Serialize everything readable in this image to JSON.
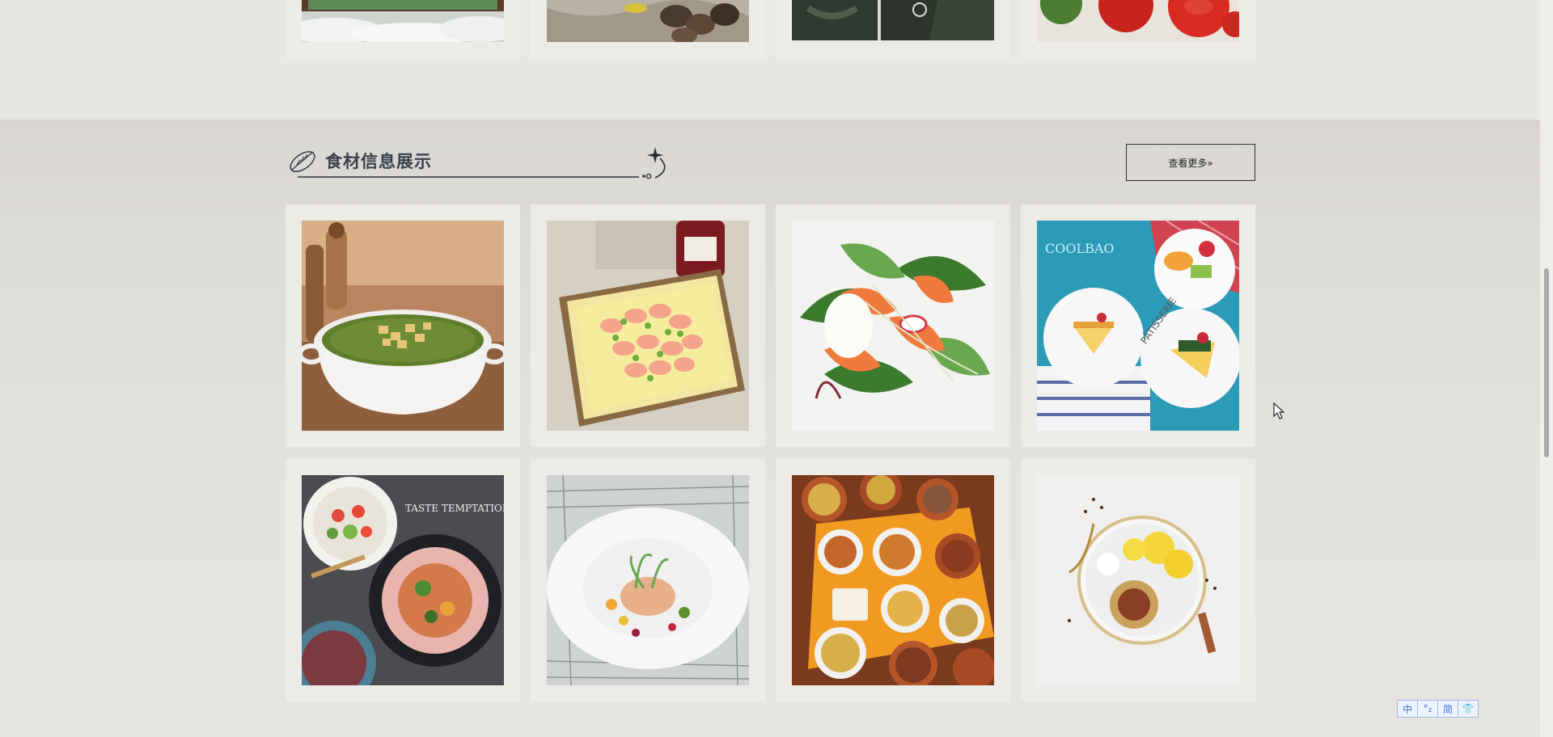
{
  "section": {
    "title": "食材信息展示",
    "more_label": "查看更多»"
  },
  "ime": {
    "items": [
      "中",
      "°₂",
      "简",
      "👕"
    ]
  },
  "colors": {
    "card_bg": "#ecebe8",
    "button_border": "#2f2f2f",
    "title_text": "#3a3f4a"
  },
  "top_row_images": [
    "landscape-with-clouds",
    "mushrooms-on-cloth",
    "dark-produce-collage",
    "red-tomatoes"
  ],
  "food_images": [
    "green-soup-with-croutons",
    "shrimp-and-peas-platter",
    "smoked-salmon-salad",
    "patisserie-cheesecake-plates",
    "taste-temptation-salads",
    "plated-tartare-dish",
    "assorted-small-dishes",
    "lemon-tea-tray"
  ],
  "image_texts": {
    "taste_temptation": "TASTE TEMPTATION",
    "coolbao": "COOLBAO",
    "patisserie": "PÂTISSERIE"
  }
}
